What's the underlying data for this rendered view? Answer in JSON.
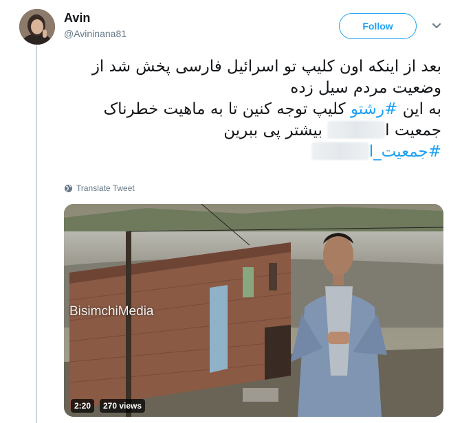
{
  "tweet": {
    "author": {
      "display_name": "Avin",
      "handle": "@Avininana81",
      "avatar_icon": "profile-photo"
    },
    "follow_label": "Follow",
    "text": {
      "line1": "بعد از اینکه اون کلیپ تو اسرائیل فارسی پخش شد از",
      "line2": "وضعیت مردم سیل زده",
      "line3_prefix": "به این ",
      "line3_hashtag": "#رشتو",
      "line3_suffix": " کلیپ توجه کنین تا به ماهیت خطرناک",
      "line4_start": "جمعیت ا",
      "line4_end": " بیشتر پی ببرین",
      "line5_hashtag": "#جمعیت_ا"
    },
    "translate_label": "Translate Tweet",
    "video": {
      "watermark": "BisimchiMedia",
      "duration": "2:20",
      "views": "270 views"
    }
  },
  "colors": {
    "accent": "#1da1f2",
    "secondary_text": "#657786",
    "thread_line": "#ccd6dd"
  }
}
